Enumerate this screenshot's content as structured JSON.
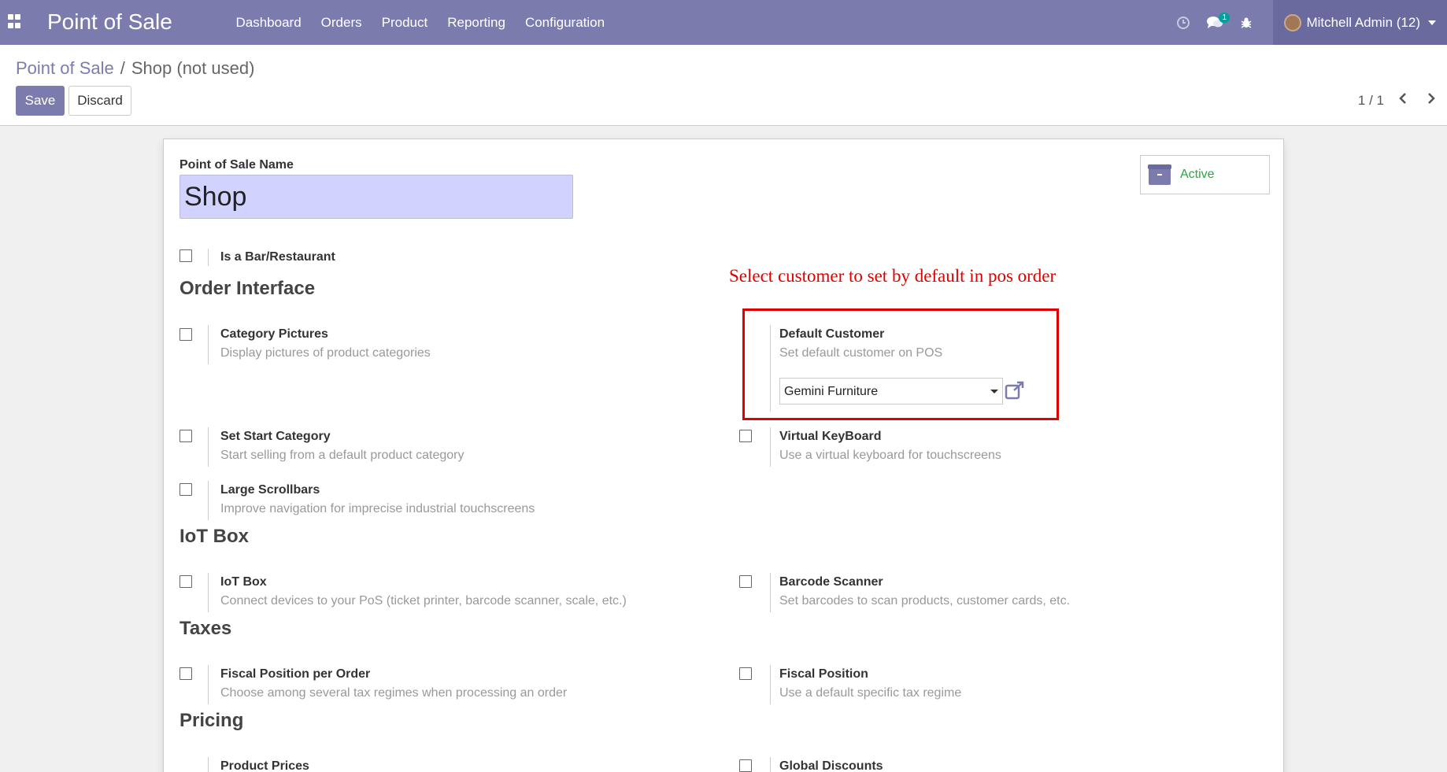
{
  "navbar": {
    "brand": "Point of Sale",
    "menu": [
      "Dashboard",
      "Orders",
      "Product",
      "Reporting",
      "Configuration"
    ],
    "messages_badge": "1",
    "user": "Mitchell Admin (12)"
  },
  "control_panel": {
    "breadcrumb_root": "Point of Sale",
    "breadcrumb_sep": "/",
    "breadcrumb_current": "Shop (not used)",
    "save_label": "Save",
    "discard_label": "Discard",
    "pager": "1 / 1"
  },
  "form": {
    "name_label": "Point of Sale Name",
    "name_value": "Shop",
    "active_label": "Active",
    "bar_restaurant": "Is a Bar/Restaurant",
    "annotation": "Select customer to set by default in pos order",
    "sections": {
      "order_interface": "Order Interface",
      "iot_box": "IoT Box",
      "taxes": "Taxes",
      "pricing": "Pricing"
    },
    "options": {
      "category_pictures": {
        "title": "Category Pictures",
        "desc": "Display pictures of product categories"
      },
      "default_customer": {
        "title": "Default Customer",
        "desc": "Set default customer on POS",
        "value": "Gemini Furniture"
      },
      "set_start_category": {
        "title": "Set Start Category",
        "desc": "Start selling from a default product category"
      },
      "virtual_keyboard": {
        "title": "Virtual KeyBoard",
        "desc": "Use a virtual keyboard for touchscreens"
      },
      "large_scrollbars": {
        "title": "Large Scrollbars",
        "desc": "Improve navigation for imprecise industrial touchscreens"
      },
      "iot_box": {
        "title": "IoT Box",
        "desc": "Connect devices to your PoS (ticket printer, barcode scanner, scale, etc.)"
      },
      "barcode_scanner": {
        "title": "Barcode Scanner",
        "desc": "Set barcodes to scan products, customer cards, etc."
      },
      "fiscal_position_per_order": {
        "title": "Fiscal Position per Order",
        "desc": "Choose among several tax regimes when processing an order"
      },
      "fiscal_position": {
        "title": "Fiscal Position",
        "desc": "Use a default specific tax regime"
      },
      "product_prices": {
        "title": "Product Prices"
      },
      "global_discounts": {
        "title": "Global Discounts"
      }
    }
  },
  "colors": {
    "navbar": "#7c7bad",
    "annotation_red": "#e00000",
    "active_green": "#28a745"
  }
}
